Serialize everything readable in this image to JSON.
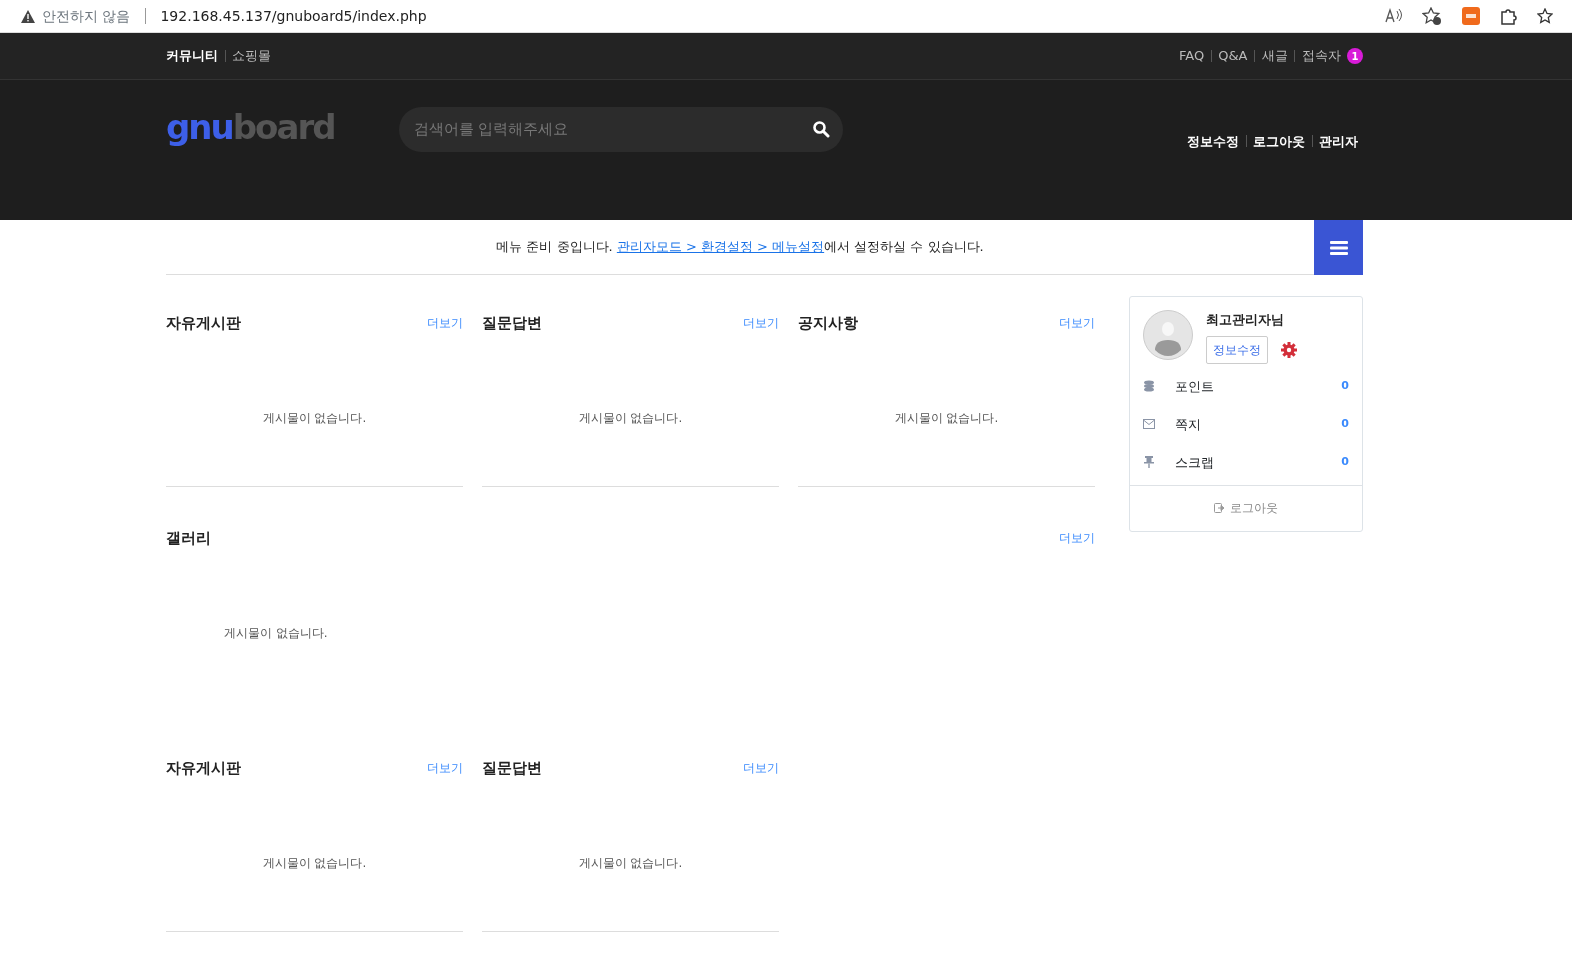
{
  "browser": {
    "security": "안전하지 않음",
    "url": "192.168.45.137/gnuboard5/index.php"
  },
  "top_links_left": [
    {
      "label": "커뮤니티",
      "selected": true
    },
    {
      "label": "쇼핑몰",
      "selected": false
    }
  ],
  "top_links_right": [
    {
      "label": "FAQ"
    },
    {
      "label": "Q&A"
    },
    {
      "label": "새글"
    },
    {
      "label": "접속자",
      "badge": "1"
    }
  ],
  "logo": {
    "part_1": "gnu",
    "part_2": "board"
  },
  "search": {
    "placeholder": "검색어를 입력해주세요"
  },
  "header_links": [
    "정보수정",
    "로그아웃",
    "관리자"
  ],
  "notice": {
    "before": "메뉴 준비 중입니다. ",
    "link": "관리자모드 > 환경설정 > 메뉴설정",
    "after": "에서 설정하실 수 있습니다."
  },
  "board_rows": [
    [
      {
        "kind": "latest",
        "title": "자유게시판",
        "more": "더보기",
        "empty": "게시물이 없습니다."
      },
      {
        "kind": "latest",
        "title": "질문답변",
        "more": "더보기",
        "empty": "게시물이 없습니다."
      },
      {
        "kind": "latest",
        "title": "공지사항",
        "more": "더보기",
        "empty": "게시물이 없습니다."
      }
    ],
    [
      {
        "kind": "gallery",
        "title": "갤러리",
        "more": "더보기",
        "empty": "게시물이 없습니다."
      }
    ],
    [
      {
        "kind": "latest",
        "title": "자유게시판",
        "more": "더보기",
        "empty": "게시물이 없습니다."
      },
      {
        "kind": "latest",
        "title": "질문답변",
        "more": "더보기",
        "empty": "게시물이 없습니다."
      }
    ]
  ],
  "member": {
    "name": "최고관리자님",
    "edit": "정보수정",
    "stats": [
      {
        "kind": "point",
        "label": "포인트",
        "value": "0"
      },
      {
        "kind": "memo",
        "label": "쪽지",
        "value": "0"
      },
      {
        "kind": "scrap",
        "label": "스크랩",
        "value": "0"
      }
    ],
    "logout": "로그아웃"
  }
}
